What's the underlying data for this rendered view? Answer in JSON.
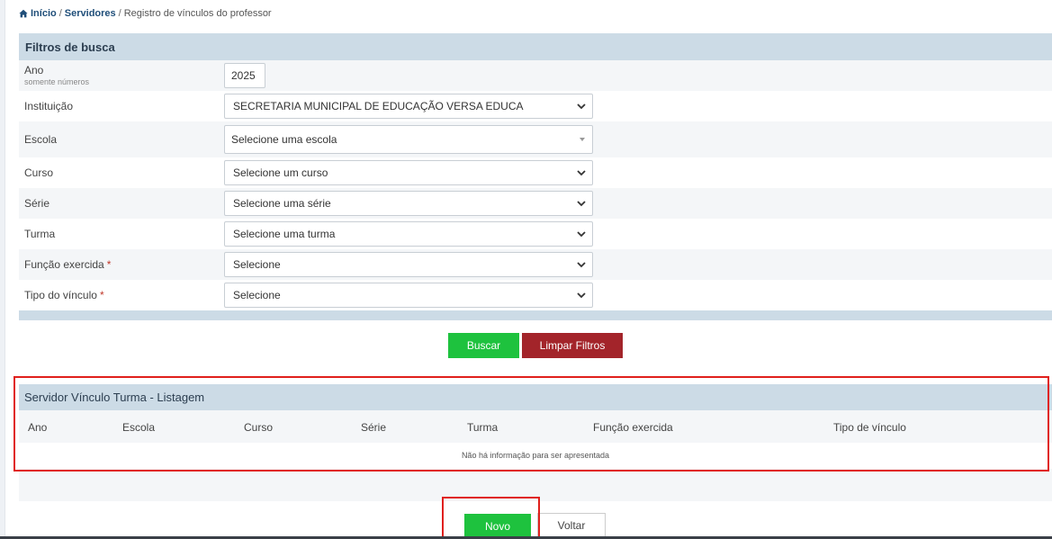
{
  "breadcrumb": {
    "home": "Início",
    "sep1": "/",
    "servidores": "Servidores",
    "sep2": "/",
    "current": "Registro de vínculos do professor"
  },
  "filters": {
    "title": "Filtros de busca",
    "ano": {
      "label": "Ano",
      "hint": "somente números",
      "value": "2025"
    },
    "instituicao": {
      "label": "Instituição",
      "value": "SECRETARIA MUNICIPAL DE EDUCAÇÃO VERSA EDUCA"
    },
    "escola": {
      "label": "Escola",
      "value": "Selecione uma escola"
    },
    "curso": {
      "label": "Curso",
      "value": "Selecione um curso"
    },
    "serie": {
      "label": "Série",
      "value": "Selecione uma série"
    },
    "turma": {
      "label": "Turma",
      "value": "Selecione uma turma"
    },
    "funcao": {
      "label": "Função exercida",
      "required": "*",
      "value": "Selecione"
    },
    "tipo": {
      "label": "Tipo do vínculo",
      "required": "*",
      "value": "Selecione"
    }
  },
  "actions": {
    "buscar": "Buscar",
    "limpar": "Limpar Filtros"
  },
  "listing": {
    "title": "Servidor Vínculo Turma - Listagem",
    "columns": [
      "Ano",
      "Escola",
      "Curso",
      "Série",
      "Turma",
      "Função exercida",
      "Tipo de vínculo"
    ],
    "empty": "Não há informação para ser apresentada"
  },
  "footer_actions": {
    "novo": "Novo",
    "voltar": "Voltar"
  },
  "colors": {
    "header_bg": "#ccdbe6",
    "green": "#1ec23e",
    "red": "#a3242a",
    "highlight": "#e0201c"
  }
}
